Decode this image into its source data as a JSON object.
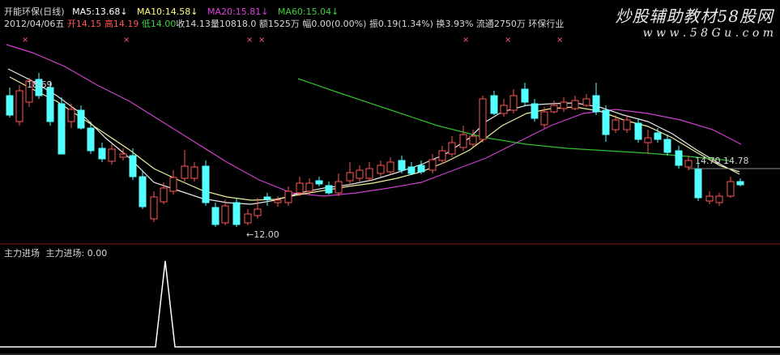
{
  "header": {
    "title": "开能环保(日线)",
    "ma5_label": "MA5:",
    "ma5_value": "13.68",
    "ma10_label": "MA10:",
    "ma10_value": "14.58",
    "ma20_label": "MA20:",
    "ma20_value": "15.81",
    "ma60_label": "MA60:",
    "ma60_value": "15.04",
    "arrow": "↓"
  },
  "quote": {
    "date": "2012/04/06",
    "weekday": "五",
    "open": "开14.15",
    "high": "高14.19",
    "low": "低14.00",
    "close": "收14.13",
    "volume": "量10818.0",
    "amount": "额1525万",
    "change": "幅0.00(0.00%)",
    "amplitude": "振0.19(1.34%)",
    "turnover": "换3.93%",
    "float": "流通2750万",
    "industry": "环保行业"
  },
  "watermark": {
    "text": "炒股辅助教材58股网",
    "url": "w w w . 5 8 G u . c o m"
  },
  "annotations": {
    "high_label": "18.69",
    "low_label": "←12.00",
    "last_label": "14.70 14.78"
  },
  "indicator": {
    "title": "主力进场",
    "formula": "主力进场: 0.00"
  },
  "colors": {
    "up": "#ff5555",
    "down": "#54ffff",
    "ma5": "#e8e8e8",
    "ma10": "#f0f0a0",
    "ma20": "#d040d0",
    "ma60": "#30c030",
    "divider": "#8b1a1a"
  },
  "chart_data": {
    "type": "candlestick",
    "series": [
      {
        "name": "MA5",
        "value": 13.68
      },
      {
        "name": "MA10",
        "value": 14.58
      },
      {
        "name": "MA20",
        "value": 15.81
      },
      {
        "name": "MA60",
        "value": 15.04
      }
    ],
    "labels": [
      "18.69",
      "12.00",
      "14.70",
      "14.78"
    ]
  }
}
